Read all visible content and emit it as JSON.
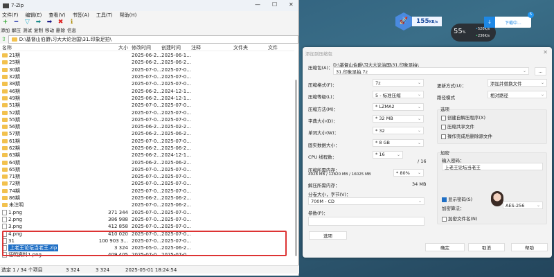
{
  "window": {
    "title": "7-Zip",
    "minimize": "—",
    "maximize": "☐",
    "close": "✕"
  },
  "menu": [
    "文件(F)",
    "编辑(E)",
    "查看(V)",
    "书签(A)",
    "工具(T)",
    "帮助(H)"
  ],
  "toolbar": [
    {
      "label": "添加",
      "icon": "+",
      "color": "#2aa52a"
    },
    {
      "label": "解压",
      "icon": "━",
      "color": "#2233aa"
    },
    {
      "label": "测试",
      "icon": "▽",
      "color": "#22aacc"
    },
    {
      "label": "复制",
      "icon": "➡",
      "color": "#1a8a8a"
    },
    {
      "label": "移动",
      "icon": "➡",
      "color": "#1a1a88"
    },
    {
      "label": "删除",
      "icon": "✖",
      "color": "#dd2222"
    },
    {
      "label": "信息",
      "icon": "ℹ",
      "color": "#aa8800"
    }
  ],
  "address": "D:\\基督山伯爵\\习大大论治国\\31.印象足拍\\",
  "columns": {
    "name": "名称",
    "size": "大小",
    "modified": "修改时间",
    "created": "创建时间",
    "comment": "注释",
    "folders": "文件夹",
    "files": "文件"
  },
  "rows": [
    {
      "name": "21期",
      "type": "folder",
      "size": "",
      "modified": "2025-06-2...",
      "created": "2025-06-1..."
    },
    {
      "name": "25期",
      "type": "folder",
      "size": "",
      "modified": "2025-06-2...",
      "created": "2025-06-2..."
    },
    {
      "name": "30期",
      "type": "folder",
      "size": "",
      "modified": "2025-07-0...",
      "created": "2025-07-0..."
    },
    {
      "name": "32期",
      "type": "folder",
      "size": "",
      "modified": "2025-07-0...",
      "created": "2025-07-0..."
    },
    {
      "name": "38期",
      "type": "folder",
      "size": "",
      "modified": "2025-07-0...",
      "created": "2025-07-0..."
    },
    {
      "name": "46期",
      "type": "folder",
      "size": "",
      "modified": "2025-06-2...",
      "created": "2024-12-1..."
    },
    {
      "name": "49期",
      "type": "folder",
      "size": "",
      "modified": "2025-06-2...",
      "created": "2024-12-1..."
    },
    {
      "name": "51期",
      "type": "folder",
      "size": "",
      "modified": "2025-07-0...",
      "created": "2025-07-0..."
    },
    {
      "name": "52期",
      "type": "folder",
      "size": "",
      "modified": "2025-07-0...",
      "created": "2025-07-0..."
    },
    {
      "name": "55期",
      "type": "folder",
      "size": "",
      "modified": "2025-07-0...",
      "created": "2025-07-0..."
    },
    {
      "name": "56期",
      "type": "folder",
      "size": "",
      "modified": "2025-06-2...",
      "created": "2025-02-2..."
    },
    {
      "name": "57期",
      "type": "folder",
      "size": "",
      "modified": "2025-06-2...",
      "created": "2025-06-2..."
    },
    {
      "name": "61期",
      "type": "folder",
      "size": "",
      "modified": "2025-07-0...",
      "created": "2025-07-0..."
    },
    {
      "name": "62期",
      "type": "folder",
      "size": "",
      "modified": "2025-06-2...",
      "created": "2025-06-2..."
    },
    {
      "name": "63期",
      "type": "folder",
      "size": "",
      "modified": "2025-06-2...",
      "created": "2024-12-1..."
    },
    {
      "name": "64期",
      "type": "folder",
      "size": "",
      "modified": "2025-06-2...",
      "created": "2025-06-2..."
    },
    {
      "name": "65期",
      "type": "folder",
      "size": "",
      "modified": "2025-07-0...",
      "created": "2025-07-0..."
    },
    {
      "name": "71期",
      "type": "folder",
      "size": "",
      "modified": "2025-07-0...",
      "created": "2025-07-0..."
    },
    {
      "name": "72期",
      "type": "folder",
      "size": "",
      "modified": "2025-07-0...",
      "created": "2025-07-0..."
    },
    {
      "name": "74期",
      "type": "folder",
      "size": "",
      "modified": "2025-07-0...",
      "created": "2025-07-0..."
    },
    {
      "name": "86期",
      "type": "folder",
      "size": "",
      "modified": "2025-06-2...",
      "created": "2025-06-2..."
    },
    {
      "name": "未注明",
      "type": "folder",
      "size": "",
      "modified": "2025-07-0...",
      "created": "2025-06-2..."
    },
    {
      "name": "1.png",
      "type": "file",
      "size": "371 344",
      "modified": "2025-07-0...",
      "created": "2025-07-0..."
    },
    {
      "name": "2.png",
      "type": "file",
      "size": "386 988",
      "modified": "2025-07-0...",
      "created": "2025-07-0..."
    },
    {
      "name": "3.png",
      "type": "file",
      "size": "412 858",
      "modified": "2025-07-0...",
      "created": "2025-07-0..."
    },
    {
      "name": "4.png",
      "type": "file",
      "size": "410 020",
      "modified": "2025-07-0...",
      "created": "2025-07-0..."
    },
    {
      "name": "31",
      "type": "file",
      "size": "100 903 3...",
      "modified": "2025-07-0...",
      "created": "2025-07-0..."
    },
    {
      "name": "上老王论坛当老王.zip",
      "type": "zip",
      "size": "3 324",
      "modified": "2025-05-0...",
      "created": "2025-06-2...",
      "selected": true
    },
    {
      "name": "证明资料1.png",
      "type": "file",
      "size": "409 405",
      "modified": "2025-07-0...",
      "created": "2025-07-0..."
    }
  ],
  "status": {
    "selection": "选定 1 / 34 个项目",
    "size": "3 324",
    "packed": "3 324",
    "date": "2025-05-01 18:24:54"
  },
  "dialog": {
    "title": "添加到压缩包",
    "close": "✕",
    "archive_label": "压缩包(A)：",
    "archive_path": "D:\\基督山伯爵\\习大大论治国\\31.印象足拍\\",
    "archive_name": "31.印象足拍.7z",
    "browse": "...",
    "format_label": "压缩格式(F)：",
    "format": "7z",
    "level_label": "压缩等级(L)：",
    "level": "5 - 标准压缩",
    "method_label": "压缩方法(M)：",
    "method": "* LZMA2",
    "dict_label": "字典大小(D)：",
    "dict": "* 32 MB",
    "word_label": "单词大小(W)：",
    "word": "* 32",
    "solid_label": "固实数据大小：",
    "solid": "* 8 GB",
    "threads_label": "CPU 线程数：",
    "threads": "* 16",
    "threads_max": "/ 16",
    "mem_label": "压缩所需内存：",
    "mem_detail": "4928 MB / 12820 MB / 16025 MB",
    "mem_pct": "* 80%",
    "decomp_label": "解压所需内存：",
    "decomp": "34 MB",
    "split_label": "分卷大小，字节(V)：",
    "split": "700M - CD",
    "params_label": "参数(P)：",
    "params": "",
    "options_btn": "选项",
    "update_label": "更新方式(U)：",
    "update": "添加并替换文件",
    "pathmode_label": "路径模式",
    "pathmode": "相对路径",
    "options_group": "选项",
    "opt1": "创建自解压程序(X)",
    "opt2": "压缩共享文件",
    "opt3": "操作完成后删除源文件",
    "enc_group": "加密",
    "pwd_label": "输入密码：",
    "pwd": "上老王论坛当老王",
    "show_pwd": "显示密码(S)",
    "enc_method_label": "加密算法：",
    "enc_method": "AES-256",
    "enc_names": "加密文件名(N)",
    "ok": "确定",
    "cancel": "取消",
    "help": "帮助"
  },
  "widgets": {
    "speed": "155",
    "speed_unit": "KB/s",
    "percent": "55",
    "pct_unit": "%",
    "up": "520",
    "down": "236",
    "rate_unit": "K/s",
    "download": "下载中...",
    "badge": "5"
  }
}
